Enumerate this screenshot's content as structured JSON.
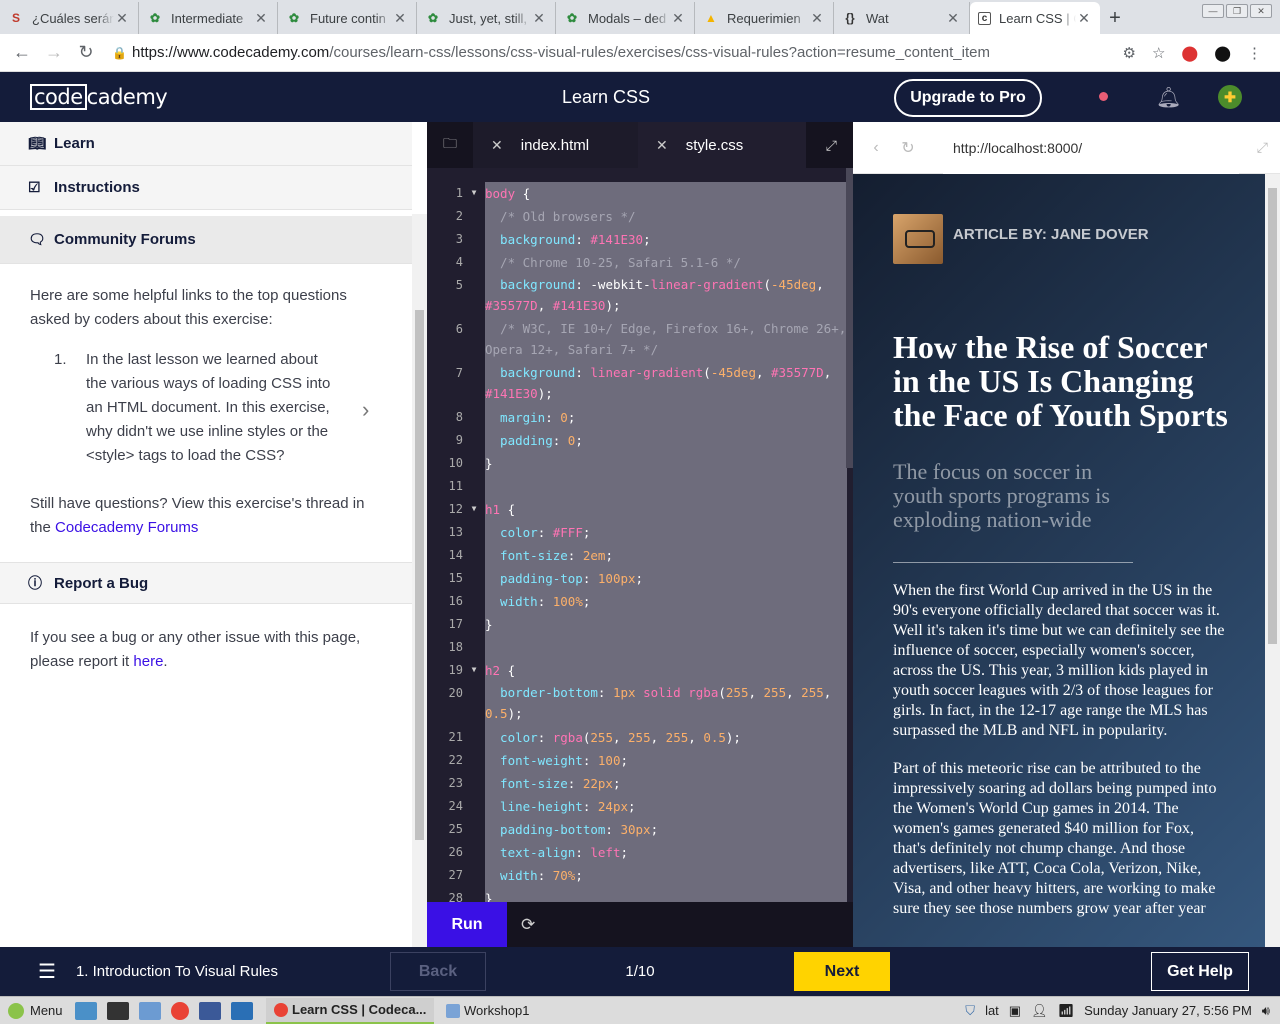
{
  "browser": {
    "tabs": [
      {
        "favicon": "S",
        "fav_color": "#c0392b",
        "title": "¿Cuáles serán"
      },
      {
        "favicon": "✿",
        "fav_color": "#2e8b3e",
        "title": "Intermediate"
      },
      {
        "favicon": "✿",
        "fav_color": "#2e8b3e",
        "title": "Future contin"
      },
      {
        "favicon": "✿",
        "fav_color": "#2e8b3e",
        "title": "Just, yet, still,"
      },
      {
        "favicon": "✿",
        "fav_color": "#2e8b3e",
        "title": "Modals – ded"
      },
      {
        "favicon": "▲",
        "fav_color": "#f4b400",
        "title": "Requerimien"
      },
      {
        "favicon": "{}",
        "fav_color": "#333333",
        "title": "Wat"
      },
      {
        "favicon": "c",
        "fav_color": "#333333",
        "title": "Learn CSS | C"
      }
    ],
    "url_host": "https://www.codecademy.com",
    "url_path": "/courses/learn-css/lessons/css-visual-rules/exercises/css-visual-rules?action=resume_content_item"
  },
  "header": {
    "logo_left": "code",
    "logo_right": "cademy",
    "course_title": "Learn CSS",
    "upgrade_label": "Upgrade to Pro"
  },
  "left_panel": {
    "learn_label": "Learn",
    "instructions_label": "Instructions",
    "forums_label": "Community Forums",
    "intro": "Here are some helpful links to the top questions asked by coders about this exercise:",
    "question_number": "1.",
    "question_text": "In the last lesson we learned about the various ways of loading CSS into an HTML document. In this exercise, why didn't we use inline styles or the <style> tags to load the CSS?",
    "still_text": "Still have questions? View this exercise's thread in the ",
    "forums_link": "Codecademy Forums",
    "bug_label": "Report a Bug",
    "bug_text": "If you see a bug or any other issue with this page, please report it ",
    "bug_link": "here",
    "bug_end": "."
  },
  "editor": {
    "tab1": "index.html",
    "tab2": "style.css",
    "run_label": "Run",
    "lines": [
      "1",
      "2",
      "3",
      "4",
      "5",
      "6",
      "7",
      "8",
      "9",
      "10",
      "11",
      "12",
      "13",
      "14",
      "15",
      "16",
      "17",
      "18",
      "19",
      "20",
      "21",
      "22",
      "23",
      "24",
      "25",
      "26",
      "27",
      "28"
    ],
    "code": {
      "l1_sel": "body",
      "l1_rest": " {",
      "l2": "  /* Old browsers */",
      "l3_p": "  background",
      "l3_v": "#141E30",
      "l4": "  /* Chrome 10-25, Safari 5.1-6 */",
      "l5_p": "  background",
      "l5_a": "-webkit-",
      "l5_f": "linear-gradient",
      "l5_n": "-45deg",
      "l5_c1": "#35577D",
      "l5_c2": "#141E30",
      "l6": "  /* W3C, IE 10+/ Edge, Firefox 16+, Chrome 26+, Opera 12+, Safari 7+ */",
      "l7_p": "  background",
      "l7_f": "linear-gradient",
      "l7_n": "-45deg",
      "l7_c1": "#35577D",
      "l7_c2": "#141E30",
      "l8_p": "  margin",
      "l8_v": "0",
      "l9_p": "  padding",
      "l9_v": "0",
      "l10": "}",
      "l12_sel": "h1",
      "l12_rest": " {",
      "l13_p": "  color",
      "l13_v": "#FFF",
      "l14_p": "  font-size",
      "l14_v": "2em",
      "l15_p": "  padding-top",
      "l15_v": "100px",
      "l16_p": "  width",
      "l16_v": "100%",
      "l17": "}",
      "l19_sel": "h2",
      "l19_rest": " {",
      "l20_p": "  border-bottom",
      "l20_n": "1px",
      "l20_k": "solid",
      "l20_f": "rgba",
      "l20_a": "255",
      "l20_b": "255",
      "l20_c": "255",
      "l20_d": "0.5",
      "l21_p": "  color",
      "l21_f": "rgba",
      "l21_a": "255",
      "l21_b": "255",
      "l21_c": "255",
      "l21_d": "0.5",
      "l22_p": "  font-weight",
      "l22_v": "100",
      "l23_p": "  font-size",
      "l23_v": "22px",
      "l24_p": "  line-height",
      "l24_v": "24px",
      "l25_p": "  padding-bottom",
      "l25_v": "30px",
      "l26_p": "  text-align",
      "l26_v": "left",
      "l27_p": "  width",
      "l27_v": "70%",
      "l28": "}"
    }
  },
  "preview": {
    "url": "http://localhost:8000/",
    "byline": "ARTICLE BY: JANE DOVER",
    "title": "How the Rise of Soccer in the US Is Changing the Face of Youth Sports",
    "subtitle": "The focus on soccer in youth sports programs is exploding nation-wide",
    "p1": "When the first World Cup arrived in the US in the 90's everyone officially declared that soccer was it. Well it's taken it's time but we can definitely see the influence of soccer, especially women's soccer, across the US. This year, 3 million kids played in youth soccer leagues with 2/3 of those leagues for girls. In fact, in the 12-17 age range the MLS has surpassed the MLB and NFL in popularity.",
    "p2": "Part of this meteoric rise can be attributed to the impressively soaring ad dollars being pumped into the Women's World Cup games in 2014. The women's games generated $40 million for Fox, that's definitely not chump change. And those advertisers, like ATT, Coca Cola, Verizon, Nike, Visa, and other heavy hitters, are working to make sure they see those numbers grow year after year"
  },
  "footer": {
    "lesson": "1. Introduction To Visual Rules",
    "back": "Back",
    "progress": "1/10",
    "next": "Next",
    "help": "Get Help"
  },
  "taskbar": {
    "menu": "Menu",
    "task1": "Learn CSS | Codeca...",
    "task2": "Workshop1",
    "lang": "lat",
    "clock": "Sunday January 27,  5:56 PM"
  }
}
